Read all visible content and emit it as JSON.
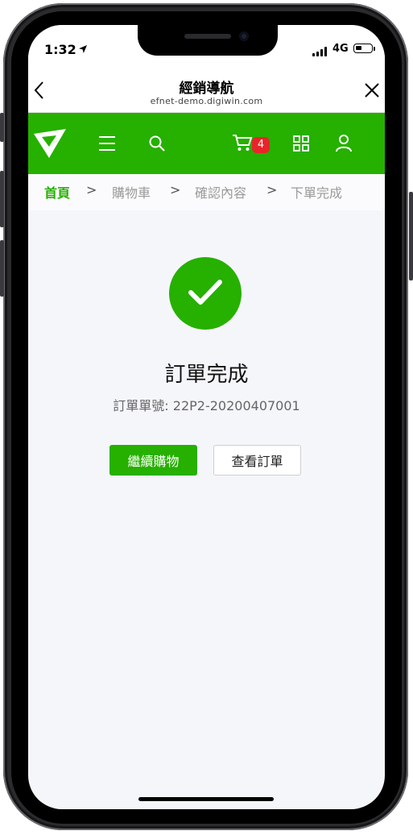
{
  "status_bar": {
    "time": "1:32",
    "network": "4G"
  },
  "nav": {
    "title": "經銷導航",
    "url": "efnet-demo.digiwin.com"
  },
  "header": {
    "cart_count": "4"
  },
  "breadcrumb": {
    "items": [
      "首頁",
      "購物車",
      "確認內容",
      "下單完成"
    ],
    "separator": ">"
  },
  "result": {
    "title": "訂單完成",
    "order_label": "訂單單號:",
    "order_number": "22P2-20200407001"
  },
  "actions": {
    "continue_label": "繼續購物",
    "view_order_label": "查看訂單"
  },
  "colors": {
    "brand_green": "#26b000",
    "badge_red": "#e8242a",
    "screen_bg": "#f5f6fa"
  },
  "icons": [
    "location-arrow-icon",
    "signal-icon",
    "battery-icon",
    "back-icon",
    "close-icon",
    "logo-icon",
    "menu-icon",
    "search-icon",
    "cart-icon",
    "grid-icon",
    "user-icon",
    "check-icon"
  ]
}
